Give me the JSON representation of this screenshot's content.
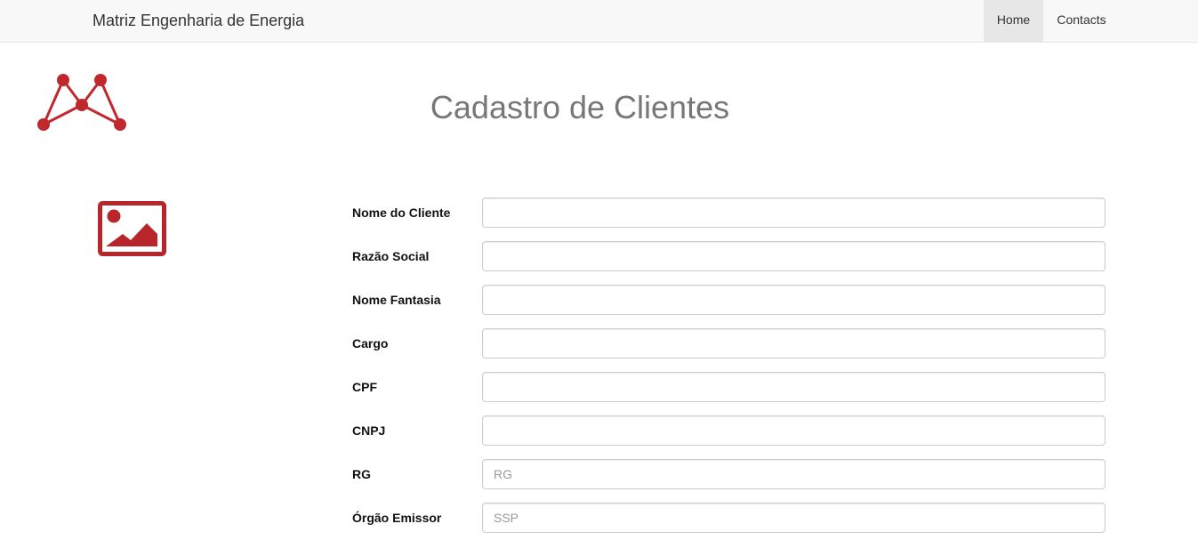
{
  "navbar": {
    "brand": "Matriz Engenharia de Energia",
    "links": [
      {
        "label": "Home",
        "active": true
      },
      {
        "label": "Contacts",
        "active": false
      }
    ]
  },
  "page": {
    "title": "Cadastro de Clientes"
  },
  "colors": {
    "accent": "#c0282d",
    "navbar_bg": "#f8f8f8",
    "active_tab_bg": "#e7e7e7",
    "title": "#777777"
  },
  "icons": {
    "logo": "matriz-logo-network",
    "photo_placeholder": "image-icon"
  },
  "form": {
    "fields": [
      {
        "label": "Nome do Cliente",
        "value": "",
        "placeholder": ""
      },
      {
        "label": "Razão Social",
        "value": "",
        "placeholder": ""
      },
      {
        "label": "Nome Fantasia",
        "value": "",
        "placeholder": ""
      },
      {
        "label": "Cargo",
        "value": "",
        "placeholder": ""
      },
      {
        "label": "CPF",
        "value": "",
        "placeholder": ""
      },
      {
        "label": "CNPJ",
        "value": "",
        "placeholder": ""
      },
      {
        "label": "RG",
        "value": "",
        "placeholder": "RG"
      },
      {
        "label": "Órgão Emissor",
        "value": "",
        "placeholder": "SSP"
      }
    ]
  }
}
